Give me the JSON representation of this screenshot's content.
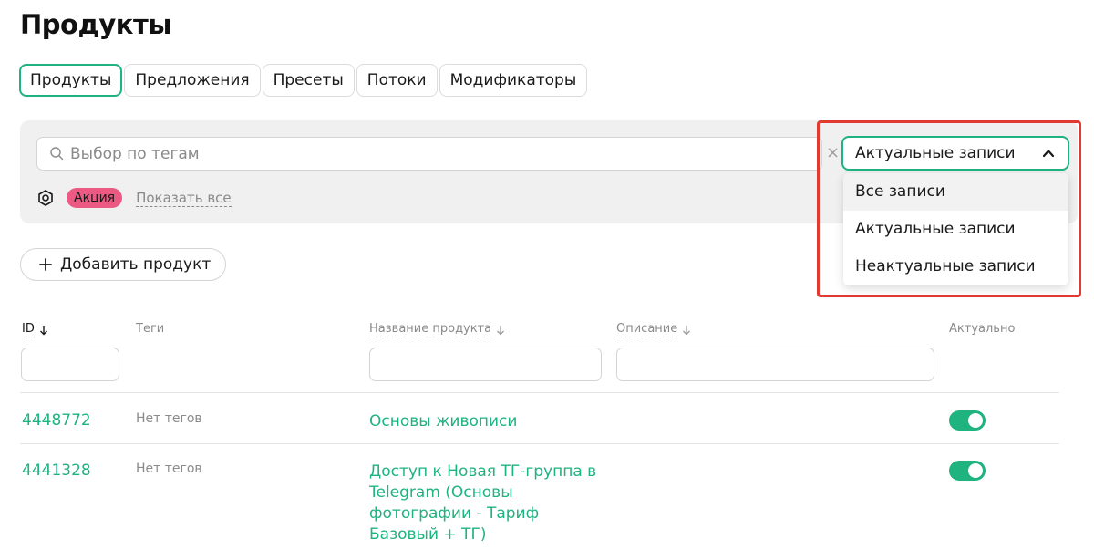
{
  "page": {
    "title": "Продукты"
  },
  "tabs": [
    {
      "label": "Продукты",
      "active": true
    },
    {
      "label": "Предложения",
      "active": false
    },
    {
      "label": "Пресеты",
      "active": false
    },
    {
      "label": "Потоки",
      "active": false
    },
    {
      "label": "Модификаторы",
      "active": false
    }
  ],
  "filters": {
    "search_placeholder": "Выбор по тегам",
    "tag": "Акция",
    "show_all": "Показать все",
    "status_select": {
      "value": "Актуальные записи",
      "options": [
        "Все записи",
        "Актуальные записи",
        "Неактуальные записи"
      ]
    }
  },
  "actions": {
    "add_product": "Добавить продукт"
  },
  "table": {
    "headers": {
      "id": "ID",
      "tags": "Теги",
      "name": "Название продукта",
      "description": "Описание",
      "active": "Актуально"
    },
    "rows": [
      {
        "id": "4448772",
        "tags": "Нет тегов",
        "name": "Основы живописи",
        "active": true
      },
      {
        "id": "4441328",
        "tags": "Нет тегов",
        "name": "Доступ к Новая ТГ-группа в Telegram (Основы фотографии - Тариф Базовый + ТГ)",
        "active": true
      }
    ]
  },
  "colors": {
    "accent": "#1fb37f",
    "tag": "#ec5a84",
    "highlight": "#e03a33"
  }
}
